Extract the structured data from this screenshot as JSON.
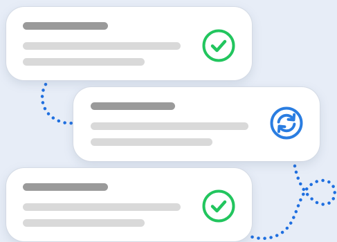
{
  "colors": {
    "background": "#e7edf7",
    "card": "#ffffff",
    "title_bar": "#9a9a9a",
    "text_bar": "#d9d9d9",
    "success": "#22c55e",
    "sync": "#2a7de1",
    "connector": "#1f6fe0"
  },
  "cards": [
    {
      "status": "completed",
      "icon": "check-circle-icon"
    },
    {
      "status": "syncing",
      "icon": "sync-icon"
    },
    {
      "status": "completed",
      "icon": "check-circle-icon"
    }
  ]
}
